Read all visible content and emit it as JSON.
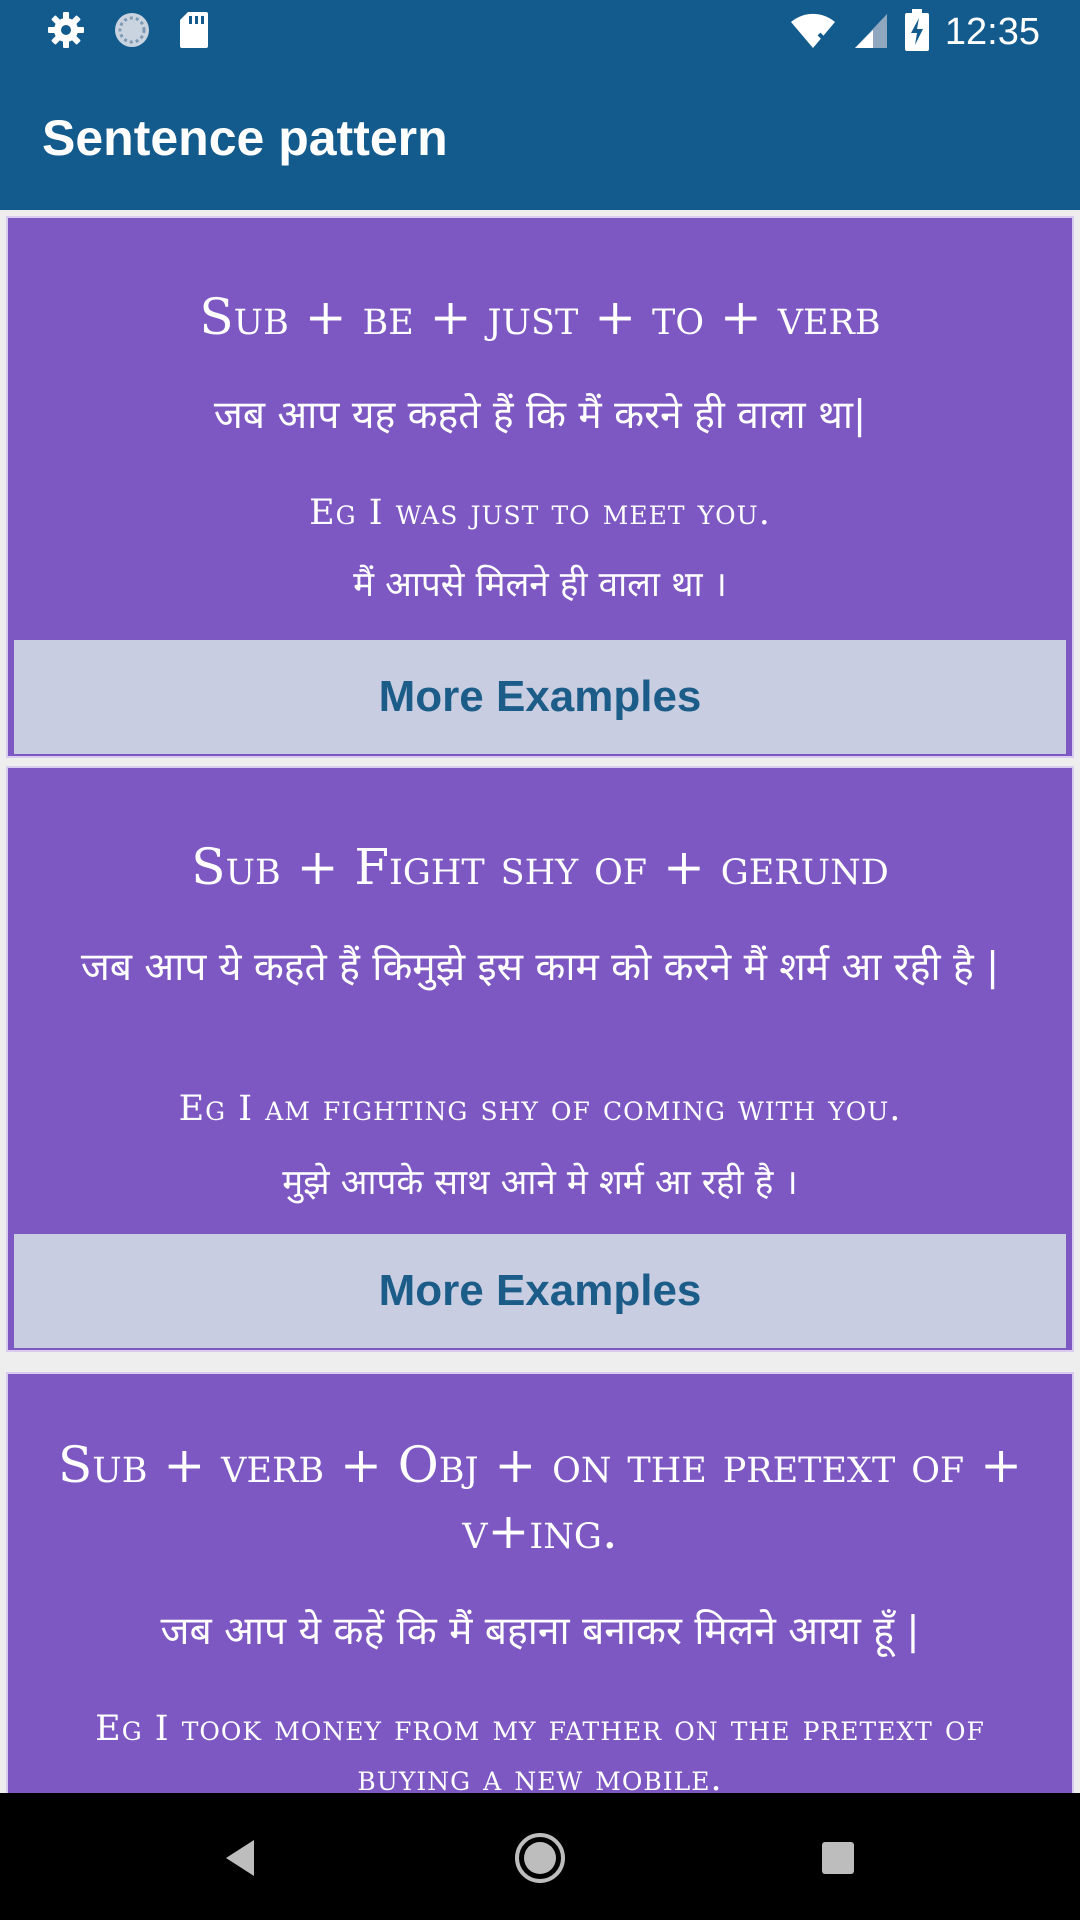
{
  "status_bar": {
    "time": "12:35",
    "left_icons": [
      "settings-icon",
      "sync-icon",
      "sd-card-icon"
    ],
    "right_icons": [
      "wifi-off-icon",
      "signal-icon",
      "battery-charging-icon"
    ]
  },
  "app_bar": {
    "title": "Sentence pattern"
  },
  "cards": [
    {
      "pattern": "Sub + be + just + to + verb",
      "hindi": "जब आप यह कहते हैं कि मैं करने ही वाला था|",
      "example": "Eg I was just to meet you.",
      "example_hindi": "मैं आपसे मिलने ही वाला था ।",
      "button": "More Examples"
    },
    {
      "pattern": "Sub + Fight shy of + gerund",
      "hindi": "जब आप ये कहते हैं किमुझे इस काम को करने मैं  शर्म आ रही है |",
      "example": "Eg I am fighting shy of coming with you.",
      "example_hindi": "मुझे आपके साथ आने मे शर्म आ रही है ।",
      "button": "More Examples"
    },
    {
      "pattern": "Sub + verb + Obj + on the pretext of + v+ing.",
      "hindi": "जब आप ये कहें कि मैं बहाना बनाकर मिलने आया हूँ |",
      "example": "Eg I took money from my father on the pretext of buying a new mobile."
    }
  ],
  "colors": {
    "primary": "#135b8d",
    "card_bg": "#7d58c3",
    "button_bg": "#c9cde2",
    "button_text": "#1b5d88"
  }
}
